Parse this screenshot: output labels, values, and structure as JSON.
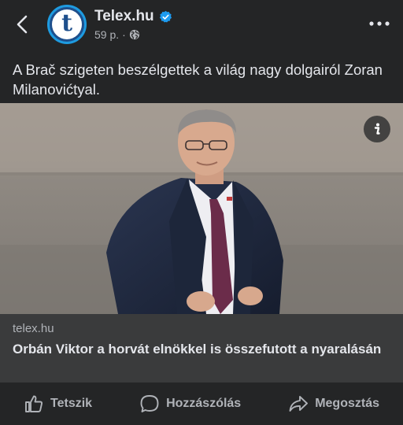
{
  "header": {
    "page_name": "Telex.hu",
    "avatar_letter": "t",
    "time": "59 p.",
    "separator": "·"
  },
  "post": {
    "text": "A Brač szigeten beszélgettek a világ nagy dolgairól Zoran Milanovićtyal."
  },
  "link": {
    "domain": "telex.hu",
    "title": "Orbán Viktor a horvát elnökkel is összefutott a nyaralásán"
  },
  "actions": {
    "like": "Tetszik",
    "comment": "Hozzászólás",
    "share": "Megosztás"
  },
  "icons": {
    "back": "chevron-left-icon",
    "verified": "verified-badge-icon",
    "audience": "globe-icon",
    "more": "more-dots-icon",
    "info": "info-icon",
    "like": "thumbs-up-icon",
    "comment": "comment-bubble-icon",
    "share": "share-arrow-icon"
  },
  "colors": {
    "background": "#242526",
    "card": "#3a3b3c",
    "text": "#e4e6eb",
    "secondary_text": "#b0b3b8",
    "verified": "#1d9bf0"
  }
}
